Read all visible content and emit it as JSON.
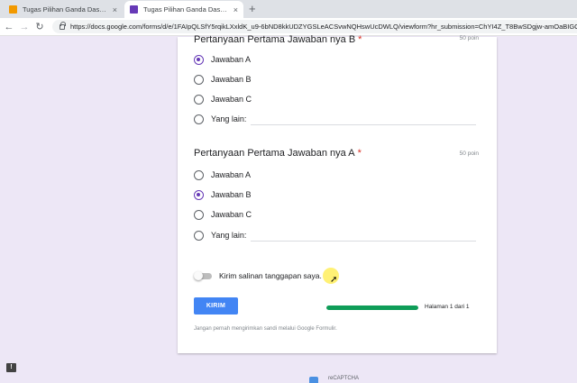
{
  "browser": {
    "tabs": [
      {
        "title": "Tugas Pilihan Ganda Dasar Desai",
        "favicon_color": "#f29900",
        "active": false
      },
      {
        "title": "Tugas Pilihan Ganda Dasar Desai",
        "favicon_color": "#673ab7",
        "active": true
      }
    ],
    "close_glyph": "×",
    "new_tab_glyph": "+",
    "back_glyph": "←",
    "forward_glyph": "→",
    "reload_glyph": "↻",
    "url": "https://docs.google.com/forms/d/e/1FAIpQLSfY5rqikLXxldK_u9-6bND8kkUDZYGSLeACSvwNQHswUcDWLQ/viewform?hr_submission=ChYI4Z_T8BwSDgjw-amOaBIGC"
  },
  "form": {
    "accent_color": "#673ab7",
    "questions": [
      {
        "title": "Pertanyaan Pertama Jawaban nya B",
        "required_mark": "*",
        "points": "50 poin",
        "options": [
          "Jawaban A",
          "Jawaban B",
          "Jawaban C"
        ],
        "other_label": "Yang lain:",
        "selected": "Jawaban A"
      },
      {
        "title": "Pertanyaan Pertama Jawaban nya A",
        "required_mark": "*",
        "points": "50 poin",
        "options": [
          "Jawaban A",
          "Jawaban B",
          "Jawaban C"
        ],
        "other_label": "Yang lain:",
        "selected": "Jawaban B"
      }
    ],
    "copy_toggle_label": "Kirim salinan tanggapan saya.",
    "copy_toggle_on": false,
    "submit_label": "KIRIM",
    "progress": 1.0,
    "progress_color": "#0f9d58",
    "page_label": "Halaman 1 dari 1",
    "footnote": "Jangan pernah mengirimkan sandi melalui Google Formulir."
  },
  "footer": {
    "recaptcha_label": "reCAPTCHA",
    "report_glyph": "!"
  }
}
